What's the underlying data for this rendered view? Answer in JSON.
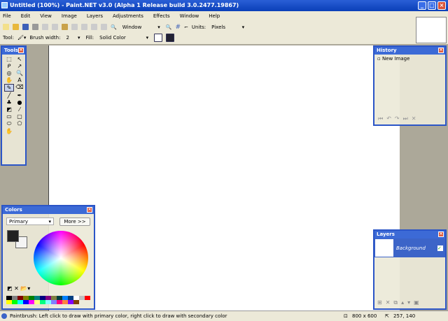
{
  "window": {
    "title": "Untitled (100%) - Paint.NET v3.0 (Alpha 1 Release build 3.0.2477.19867)",
    "min": "_",
    "max": "□",
    "close": "×"
  },
  "menu": [
    "File",
    "Edit",
    "View",
    "Image",
    "Layers",
    "Adjustments",
    "Effects",
    "Window",
    "Help"
  ],
  "toolbar": {
    "zoom_select": "Window",
    "units_label": "Units:",
    "units_value": "Pixels"
  },
  "tool_options": {
    "tool_label": "Tool:",
    "brush_width_label": "Brush width:",
    "brush_width": "2",
    "fill_label": "Fill:",
    "fill_value": "Solid Color"
  },
  "tools": {
    "title": "Tools",
    "glyphs": [
      "⬚",
      "↖",
      "ᑭ",
      "↗",
      "◎",
      "🔍",
      "✋",
      "A",
      "✎",
      "⌫",
      "╱",
      "✒",
      "♣",
      "●",
      "◩",
      "⁄",
      "▭",
      "▢",
      "⬭",
      "⬠",
      "✋",
      ""
    ]
  },
  "history": {
    "title": "History",
    "items": [
      "New Image"
    ]
  },
  "colors": {
    "title": "Colors",
    "mode": "Primary",
    "more_button": "More >>",
    "primary": "#222222",
    "secondary": "#f4f4f4",
    "palette": [
      "#000000",
      "#808080",
      "#800000",
      "#808000",
      "#008000",
      "#008080",
      "#000080",
      "#800080",
      "#808040",
      "#004040",
      "#0080ff",
      "#004080",
      "#ffffff",
      "#c0c0c0",
      "#ff0000",
      "#ffff00",
      "#00ff00",
      "#00ffff",
      "#0000ff",
      "#ff00ff",
      "#ffff80",
      "#00ff80",
      "#80ffff",
      "#8080ff",
      "#ff0080",
      "#ff8040",
      "#8000ff",
      "#804000"
    ]
  },
  "layers": {
    "title": "Layers",
    "items": [
      {
        "name": "Background",
        "visible": true
      }
    ]
  },
  "status": {
    "hint": "Paintbrush: Left click to draw with primary color, right click to draw with secondary color",
    "image_size": "800 x 600",
    "cursor": "257, 140"
  }
}
